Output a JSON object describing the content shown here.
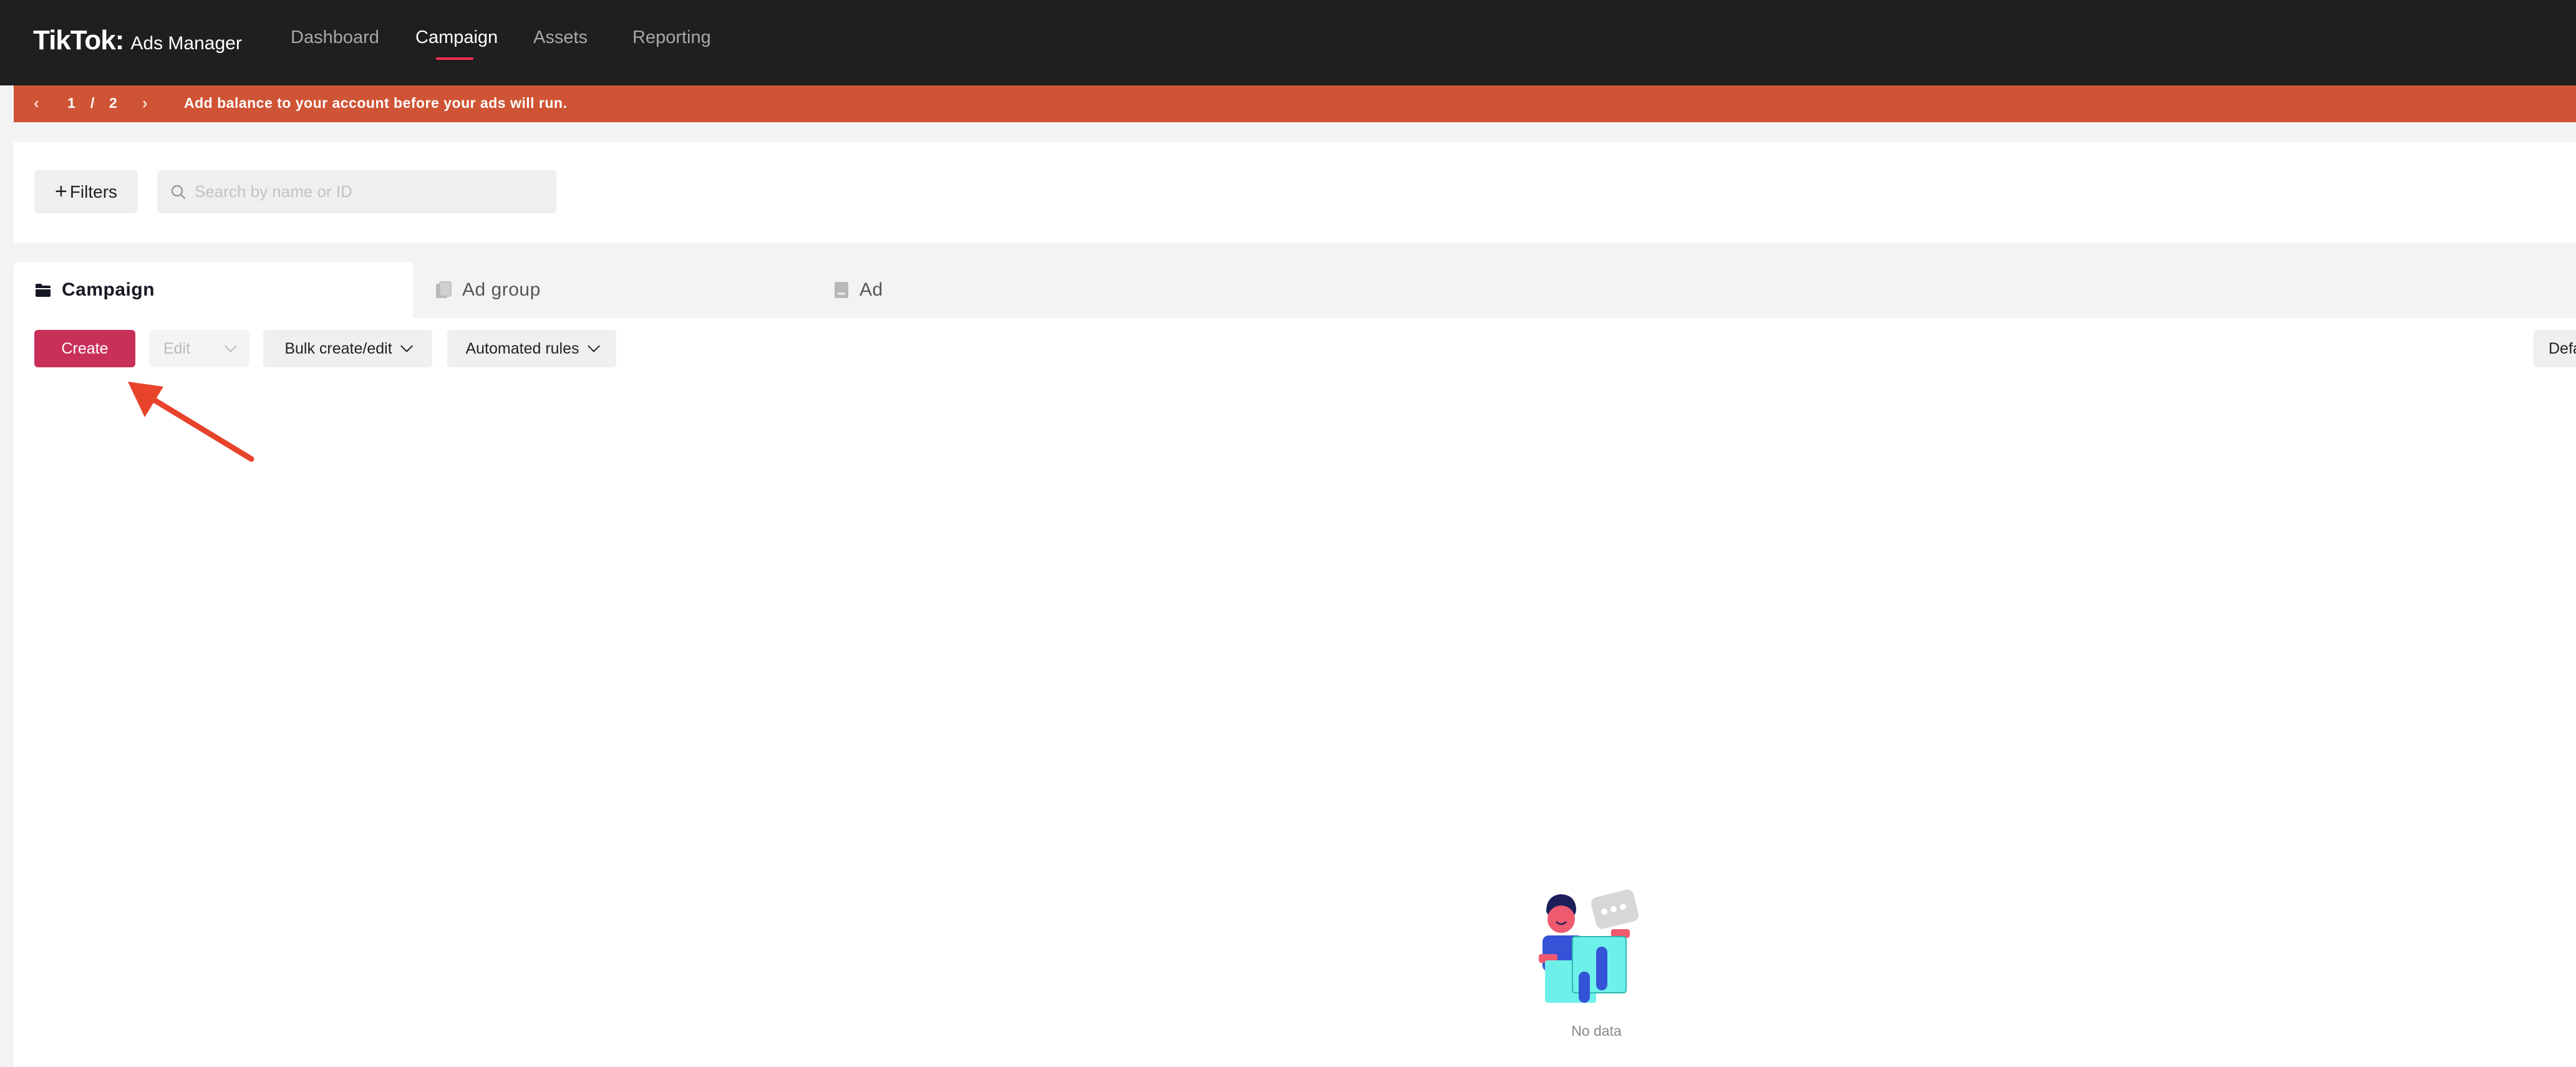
{
  "topnav": {
    "brand_logo": "TikTok",
    "brand_separator": ":",
    "brand_sub": "Ads Manager",
    "items": [
      {
        "label": "Dashboard",
        "active": false
      },
      {
        "label": "Campaign",
        "active": true
      },
      {
        "label": "Assets",
        "active": false
      },
      {
        "label": "Reporting",
        "active": false
      }
    ],
    "accent_color": "#fe2c55"
  },
  "banner": {
    "page_current": "1",
    "page_sep": "/",
    "page_total": "2",
    "prev_icon": "chevron-left-icon",
    "next_icon": "chevron-right-icon",
    "message": "Add balance to your account before your ads will run.",
    "color": "#cf5435"
  },
  "filters": {
    "button_label": "Filters",
    "search_placeholder": "Search by name or ID"
  },
  "tabs": [
    {
      "label": "Campaign",
      "icon": "folder-icon",
      "active": true
    },
    {
      "label": "Ad group",
      "icon": "ad-group-icon",
      "active": false
    },
    {
      "label": "Ad",
      "icon": "ad-icon",
      "active": false
    }
  ],
  "toolbar": {
    "create_label": "Create",
    "edit_label": "Edit",
    "bulk_label": "Bulk create/edit",
    "auto_label": "Automated rules",
    "default_label": "Default",
    "create_color": "#c8305a"
  },
  "annotation": {
    "icon": "red-arrow-icon",
    "color": "#e8432b"
  },
  "empty_state": {
    "text": "No data",
    "illustration": "empty-state-illustration"
  }
}
